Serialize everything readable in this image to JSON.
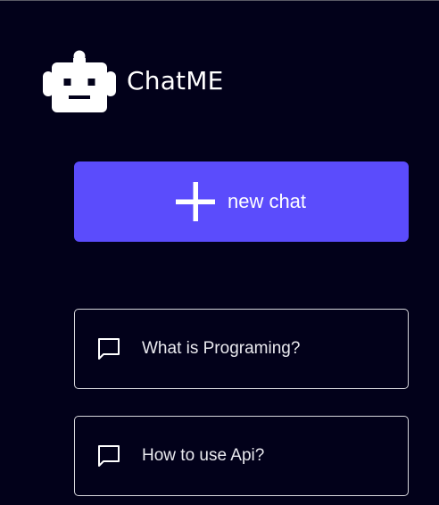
{
  "brand": {
    "name": "ChatME",
    "logo_icon": "robot-icon"
  },
  "new_chat": {
    "label": "new chat",
    "icon": "plus-icon"
  },
  "history": [
    {
      "title": "What is Programing?",
      "icon": "chat-bubble-icon"
    },
    {
      "title": "How to use Api?",
      "icon": "chat-bubble-icon"
    }
  ],
  "colors": {
    "background": "#02011a",
    "accent": "#5b4cfc",
    "text": "#ffffff",
    "border": "#d7d7dc"
  }
}
